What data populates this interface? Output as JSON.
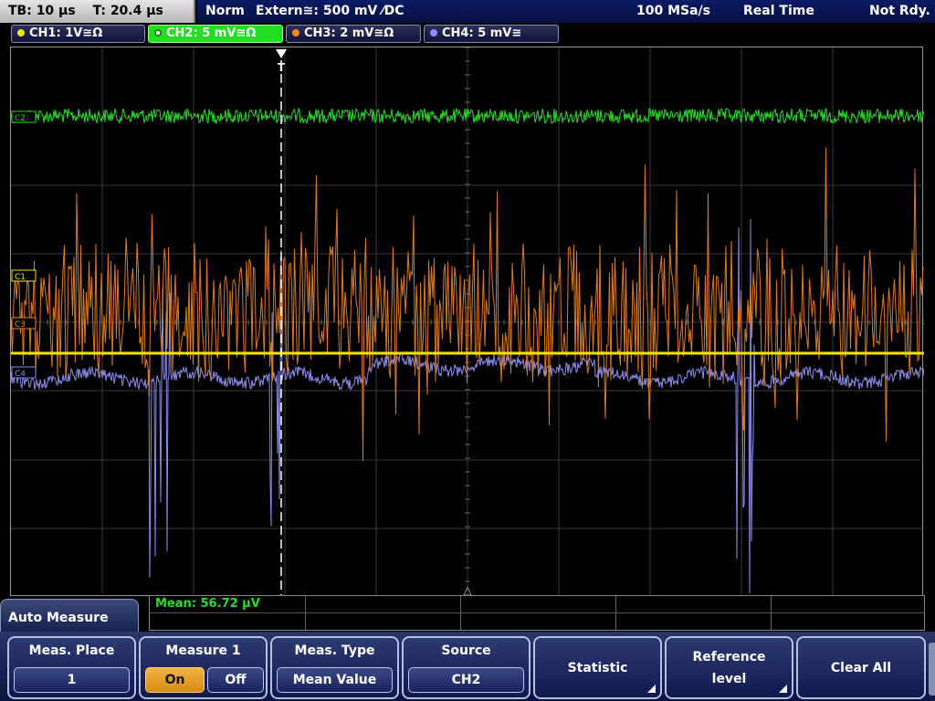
{
  "timebase": {
    "tb": "TB: 10 µs",
    "t": "T: 20.4 µs"
  },
  "status": {
    "mode": "Norm",
    "trigger": "Extern≅: 500 mV ⁄DC",
    "samplerate": "100 MSa/s",
    "acq": "Real Time",
    "state": "Not Rdy."
  },
  "channels": [
    {
      "label": "CH1: 1V≅Ω",
      "color": "#f2e600",
      "active": false
    },
    {
      "label": "CH2: 5 mV≅Ω",
      "color": "#22dd22",
      "active": true
    },
    {
      "label": "CH3: 2 mV≅Ω",
      "color": "#f08a2a",
      "active": false
    },
    {
      "label": "CH4: 5 mV≅",
      "color": "#8c8cf0",
      "active": false
    }
  ],
  "markers": {
    "ch2": "C2",
    "ch1": "C1",
    "ch3": "C3",
    "ch4": "C4",
    "trigger": "T"
  },
  "measurement": {
    "mean": "Mean: 56.72 µV"
  },
  "menu": {
    "title": "Auto Measure",
    "meas_place": {
      "title": "Meas. Place",
      "value": "1"
    },
    "measure1": {
      "title": "Measure 1",
      "on": "On",
      "off": "Off",
      "state": "On"
    },
    "meas_type": {
      "title": "Meas. Type",
      "value": "Mean Value"
    },
    "source": {
      "title": "Source",
      "value": "CH2"
    },
    "statistic": "Statistic",
    "reference_level": "Reference level",
    "clear_all": "Clear All"
  },
  "colors": {
    "ch1": "#f2e600",
    "ch2": "#22dd22",
    "ch3": "#f08a2a",
    "ch4": "#8c8cf0",
    "grid": "#3a3a3a"
  }
}
